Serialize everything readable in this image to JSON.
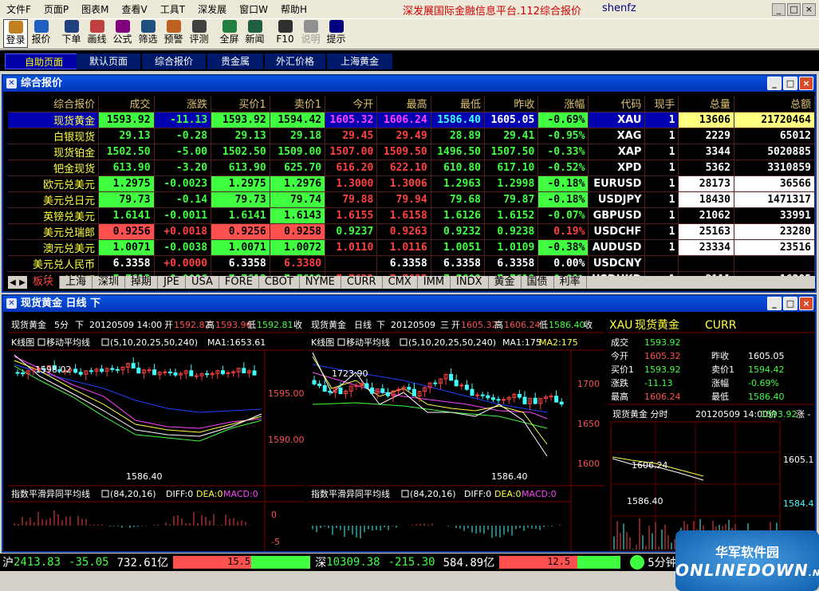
{
  "menu": {
    "items": [
      "文件F",
      "页面P",
      "图表M",
      "查看V",
      "工具T",
      "深发展",
      "窗口W",
      "帮助H"
    ],
    "app_title": "深发展国际金融信息平台.112综合报价",
    "user": "shenfz"
  },
  "toolbar": {
    "buttons": [
      {
        "label": "登录",
        "icon": "login-icon",
        "color": "#c08020"
      },
      {
        "label": "报价",
        "icon": "quote-icon",
        "color": "#2060c0"
      },
      {
        "label": "下单",
        "icon": "order-icon",
        "color": "#204080"
      },
      {
        "label": "画线",
        "icon": "pen-icon",
        "color": "#c04040"
      },
      {
        "label": "公式",
        "icon": "formula-icon",
        "color": "#800080"
      },
      {
        "label": "筛选",
        "icon": "filter-icon",
        "color": "#205080"
      },
      {
        "label": "预警",
        "icon": "alert-icon",
        "color": "#c06020"
      },
      {
        "label": "评测",
        "icon": "test-icon",
        "color": "#404040"
      },
      {
        "label": "全屏",
        "icon": "fullscreen-icon",
        "color": "#208040"
      },
      {
        "label": "新闻",
        "icon": "news-icon",
        "color": "#206040"
      },
      {
        "label": "F10",
        "icon": "f10-icon",
        "color": "#303030"
      },
      {
        "label": "说明",
        "icon": "info-icon",
        "color": "#909090"
      },
      {
        "label": "提示",
        "icon": "help-icon",
        "color": "#000080"
      }
    ]
  },
  "pages": {
    "tabs": [
      "自助页面",
      "默认页面",
      "综合报价",
      "贵金属",
      "外汇价格",
      "上海黄金"
    ],
    "active": 0
  },
  "quote_window": {
    "title": "综合报价"
  },
  "quote_table": {
    "headers": [
      "综合报价",
      "成交",
      "涨跌",
      "买价1",
      "卖价1",
      "今开",
      "最高",
      "最低",
      "昨收",
      "涨幅",
      "代码",
      "现手",
      "总量",
      "总额"
    ],
    "rows": [
      {
        "name": "现货黄金",
        "last": "1593.92",
        "chg": "-11.13",
        "bid": "1593.92",
        "ask": "1594.42",
        "open": "1605.32",
        "high": "1606.24",
        "low": "1586.40",
        "prev": "1605.05",
        "pct": "-0.69%",
        "code": "XAU",
        "hand": "1",
        "vol": "13606",
        "amt": "21720464"
      },
      {
        "name": "白银现货",
        "last": "29.13",
        "chg": "-0.28",
        "bid": "29.13",
        "ask": "29.18",
        "open": "29.45",
        "high": "29.49",
        "low": "28.89",
        "prev": "29.41",
        "pct": "-0.95%",
        "code": "XAG",
        "hand": "1",
        "vol": "2229",
        "amt": "65012"
      },
      {
        "name": "现货铂金",
        "last": "1502.50",
        "chg": "-5.00",
        "bid": "1502.50",
        "ask": "1509.00",
        "open": "1507.00",
        "high": "1509.50",
        "low": "1496.50",
        "prev": "1507.50",
        "pct": "-0.33%",
        "code": "XAP",
        "hand": "1",
        "vol": "3344",
        "amt": "5020885"
      },
      {
        "name": "钯金现货",
        "last": "613.90",
        "chg": "-3.20",
        "bid": "613.90",
        "ask": "625.70",
        "open": "616.20",
        "high": "622.10",
        "low": "610.80",
        "prev": "617.10",
        "pct": "-0.52%",
        "code": "XPD",
        "hand": "1",
        "vol": "5362",
        "amt": "3310859"
      },
      {
        "name": "欧元兑美元",
        "last": "1.2975",
        "chg": "-0.0023",
        "bid": "1.2975",
        "ask": "1.2976",
        "open": "1.3000",
        "high": "1.3006",
        "low": "1.2963",
        "prev": "1.2998",
        "pct": "-0.18%",
        "code": "EURUSD",
        "hand": "1",
        "vol": "28173",
        "amt": "36566"
      },
      {
        "name": "美元兑日元",
        "last": "79.73",
        "chg": "-0.14",
        "bid": "79.73",
        "ask": "79.74",
        "open": "79.88",
        "high": "79.94",
        "low": "79.68",
        "prev": "79.87",
        "pct": "-0.18%",
        "code": "USDJPY",
        "hand": "1",
        "vol": "18430",
        "amt": "1471317"
      },
      {
        "name": "英镑兑美元",
        "last": "1.6141",
        "chg": "-0.0011",
        "bid": "1.6141",
        "ask": "1.6143",
        "open": "1.6155",
        "high": "1.6158",
        "low": "1.6126",
        "prev": "1.6152",
        "pct": "-0.07%",
        "code": "GBPUSD",
        "hand": "1",
        "vol": "21062",
        "amt": "33991"
      },
      {
        "name": "美元兑瑞郎",
        "last": "0.9256",
        "chg": "+0.0018",
        "bid": "0.9256",
        "ask": "0.9258",
        "open": "0.9237",
        "high": "0.9263",
        "low": "0.9232",
        "prev": "0.9238",
        "pct": "0.19%",
        "code": "USDCHF",
        "hand": "1",
        "vol": "25163",
        "amt": "23280"
      },
      {
        "name": "澳元兑美元",
        "last": "1.0071",
        "chg": "-0.0038",
        "bid": "1.0071",
        "ask": "1.0072",
        "open": "1.0110",
        "high": "1.0116",
        "low": "1.0051",
        "prev": "1.0109",
        "pct": "-0.38%",
        "code": "AUDUSD",
        "hand": "1",
        "vol": "23334",
        "amt": "23516"
      },
      {
        "name": "美元兑人民币",
        "last": "6.3358",
        "chg": "+0.0000",
        "bid": "6.3358",
        "ask": "6.3380",
        "open": "",
        "high": "6.3358",
        "low": "6.3358",
        "prev": "6.3358",
        "pct": "0.00%",
        "code": "USDCNY",
        "hand": "",
        "vol": "",
        "amt": ""
      },
      {
        "name": "美元兑港币",
        "last": "7.7613",
        "chg": "-0.0006",
        "bid": "7.7613",
        "ask": "7.7618",
        "open": "7.7622",
        "high": "7.7625",
        "low": "7.7608",
        "prev": "7.7619",
        "pct": "-0.01%",
        "code": "USDHKD",
        "hand": "1",
        "vol": "2111",
        "amt": "16385"
      }
    ]
  },
  "board_tabs": [
    "板块",
    "上海",
    "深圳",
    "掉期",
    "JPE",
    "USA",
    "FORE",
    "CBOT",
    "NYME",
    "CURR",
    "CMX",
    "IMM",
    "INDX",
    "黄金",
    "国债",
    "利率"
  ],
  "chart_window": {
    "title": "现货黄金 日线 下"
  },
  "left_chart": {
    "header_name": "现货黄金",
    "period": "5分",
    "dir": "下",
    "date": "20120509 14:00",
    "open_label": "开",
    "open": "1592.82",
    "high_label": "高",
    "high": "1593.96",
    "low_label": "低",
    "low": "1592.81",
    "close_label": "收",
    "ma_title": "K线图",
    "ma_name": "移动平均线",
    "ma_params": "(5,10,20,25,50,240)",
    "ma1": "MA1:1653.61",
    "y_labels": [
      "1595.00",
      "1590.00"
    ],
    "hi_mark": "1598.02",
    "lo_mark": "1586.40",
    "macd_title": "指数平滑异同平均线",
    "macd_params": "(84,20,16)",
    "diff": "DIFF:0",
    "dea": "DEA:0",
    "macd": "MACD:0",
    "macd_labels": [
      "0",
      "-5"
    ]
  },
  "right_chart": {
    "header_name": "现货黄金",
    "period": "日线",
    "dir": "下",
    "date": "20120509",
    "weekday": "三",
    "open_label": "开",
    "open": "1605.32",
    "high_label": "高",
    "high": "1606.24",
    "low_label": "低",
    "low": "1586.40",
    "close_label": "收",
    "ma_title": "K线图",
    "ma_name": "移动平均线",
    "ma_params": "(5,10,20,25,50,240)",
    "ma1": "MA1:175",
    "ma2": "MA2:175",
    "y_labels": [
      "1700",
      "1650",
      "1600"
    ],
    "hi_mark": "1723.90",
    "lo_mark": "1586.40",
    "macd_title": "指数平滑异同平均线",
    "macd_params": "(84,20,16)",
    "diff": "DIFF:0",
    "dea": "DEA:0",
    "macd": "MACD:0"
  },
  "info_panel": {
    "code": "XAU",
    "name": "现货黄金",
    "market": "CURR",
    "fields": [
      {
        "l1": "成交",
        "v1": "1593.92",
        "l2": "",
        "v2": ""
      },
      {
        "l1": "今开",
        "v1": "1605.32",
        "l2": "昨收",
        "v2": "1605.05"
      },
      {
        "l1": "买价1",
        "v1": "1593.92",
        "l2": "卖价1",
        "v2": "1594.42"
      },
      {
        "l1": "涨跌",
        "v1": "-11.13",
        "l2": "涨幅",
        "v2": "-0.69%"
      },
      {
        "l1": "最高",
        "v1": "1606.24",
        "l2": "最低",
        "v2": "1586.40"
      }
    ]
  },
  "mini_chart": {
    "title": "现货黄金 分时",
    "date": "20120509 14:00价",
    "price": "1593.92",
    "suffix": "涨 -",
    "labels": [
      "1605.1",
      "1584.4"
    ],
    "marks": [
      "1606.24",
      "1586.40"
    ]
  },
  "status": {
    "sh_label": "沪",
    "sh_index": "2413.83",
    "sh_chg": "-35.05",
    "sh_amt": "732.61亿",
    "sh_bar": "15.5",
    "sz_label": "深",
    "sz_index": "10309.38",
    "sz_chg": "-215.30",
    "sz_amt": "584.89亿",
    "sz_bar": "12.5",
    "right_text": "5分钟:XA"
  },
  "watermark": {
    "line1": "华军软件园",
    "line2": "ONLINEDOWN",
    "line3": ".NET"
  }
}
